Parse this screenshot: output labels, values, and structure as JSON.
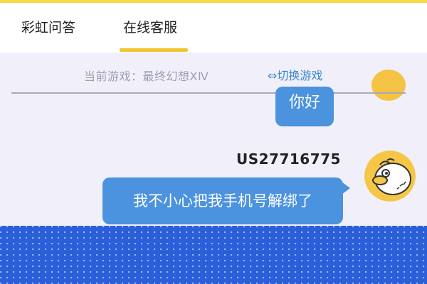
{
  "tabs": [
    {
      "label": "彩虹问答"
    },
    {
      "label": "在线客服"
    }
  ],
  "active_tab": "在线客服",
  "game_bar": {
    "current": "当前游戏：最终幻想ⅩⅣ",
    "switch": "⇔切换游戏"
  },
  "messages": [
    {
      "text": "你好"
    },
    {
      "sender": "US27716775",
      "text": "我不小心把我手机号解绑了"
    }
  ],
  "colors": {
    "accent": "#f3c431",
    "bubble": "#4b92df",
    "link": "#3b86d1",
    "background": "#f1f0fa",
    "overlay": "#2a5fd9"
  },
  "icons": {
    "avatar": "cartoon-pufferfish-avatar"
  }
}
